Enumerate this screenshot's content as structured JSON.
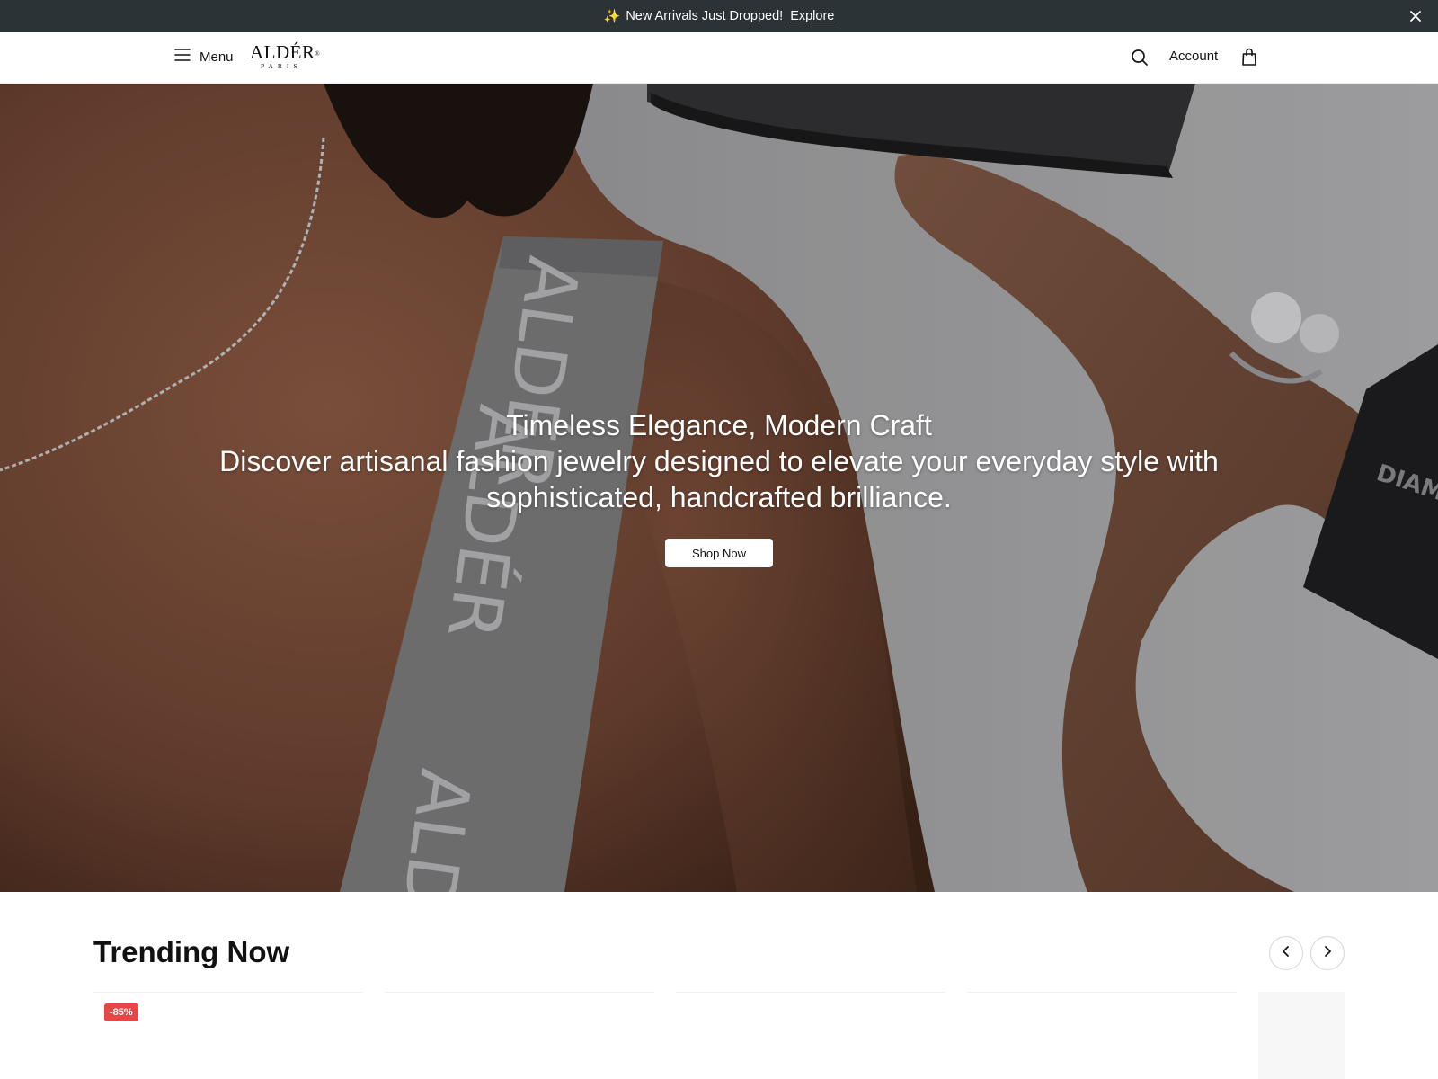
{
  "announcement": {
    "sparkle": "✨",
    "message": "New Arrivals Just Dropped!",
    "link": "Explore",
    "close_icon": "close-icon"
  },
  "header": {
    "menu_label": "Menu",
    "menu_icon": "hamburger-icon",
    "logo_word": "ALDÉR",
    "logo_reg": "®",
    "logo_sub": "PARIS",
    "search_icon": "search-icon",
    "account_label": "Account",
    "cart_icon": "shopping-bag-icon"
  },
  "hero": {
    "title": "Timeless Elegance, Modern Craft",
    "subtitle": "Discover artisanal fashion jewelry designed to elevate your everyday style with sophisticated, handcrafted brilliance.",
    "cta": "Shop Now",
    "ribbon_text": "ALDÉR",
    "box_text": "DIAMO"
  },
  "trending": {
    "title": "Trending Now",
    "prev_icon": "chevron-left-icon",
    "next_icon": "chevron-right-icon",
    "products": [
      {
        "badge": "-85%"
      },
      {
        "badge": ""
      },
      {
        "badge": ""
      },
      {
        "badge": ""
      },
      {
        "badge": ""
      }
    ]
  },
  "colors": {
    "announcement_bg": "#2b3336",
    "badge_bg": "#e84545",
    "white": "#ffffff"
  }
}
